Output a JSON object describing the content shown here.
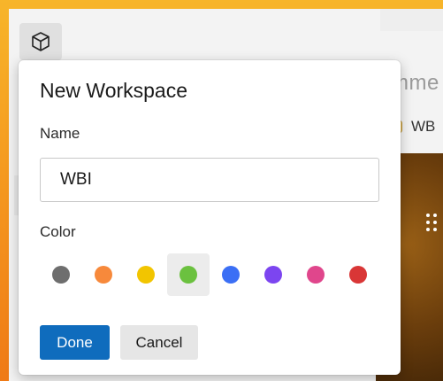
{
  "background": {
    "search_peek_text": "mme",
    "tab_peek_label": "WB"
  },
  "workspace_button": {
    "icon": "cube-icon"
  },
  "dialog": {
    "title": "New Workspace",
    "name_label": "Name",
    "name_value": "WBI",
    "color_label": "Color",
    "colors": [
      {
        "name": "gray",
        "hex": "#6e6e6e",
        "selected": false
      },
      {
        "name": "orange",
        "hex": "#f7893b",
        "selected": false
      },
      {
        "name": "yellow",
        "hex": "#f2c500",
        "selected": false
      },
      {
        "name": "green",
        "hex": "#6bc13f",
        "selected": true
      },
      {
        "name": "blue",
        "hex": "#3b6ff5",
        "selected": false
      },
      {
        "name": "purple",
        "hex": "#7c45f0",
        "selected": false
      },
      {
        "name": "pink",
        "hex": "#e0468c",
        "selected": false
      },
      {
        "name": "red",
        "hex": "#d93636",
        "selected": false
      }
    ],
    "done_label": "Done",
    "cancel_label": "Cancel"
  },
  "colors": {
    "accent": "#0f6cbd",
    "selected_swatch_bg": "#ececec"
  }
}
